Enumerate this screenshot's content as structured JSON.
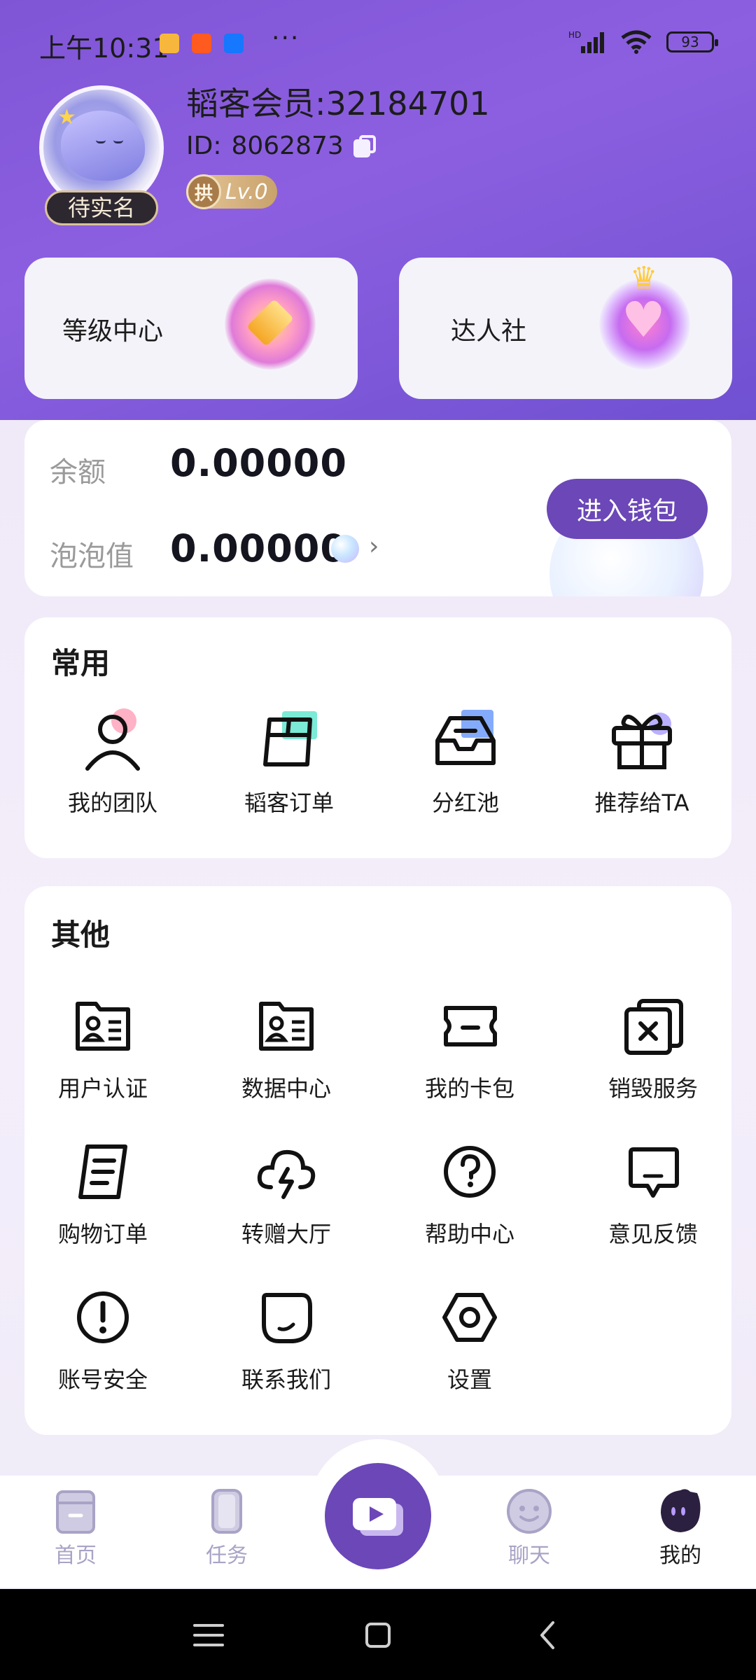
{
  "status_bar": {
    "time": "上午10:31",
    "dots": "···",
    "network": "HD",
    "battery": "93"
  },
  "profile": {
    "nickname": "韬客会员:32184701",
    "id_label": "ID:",
    "id_value": "8062873",
    "verify_badge": "待实名",
    "level": "Lv.0",
    "level_badge_char": "拱"
  },
  "top_cards": {
    "level_center": "等级中心",
    "talent_club": "达人社"
  },
  "wallet": {
    "balance_label": "余额",
    "balance_value": "0.00000",
    "bubble_label": "泡泡值",
    "bubble_value": "0.00000",
    "arrow": "›",
    "button": "进入钱包"
  },
  "common": {
    "title": "常用",
    "items": [
      {
        "label": "我的团队",
        "icon": "team-icon"
      },
      {
        "label": "韬客订单",
        "icon": "order-box-icon"
      },
      {
        "label": "分红池",
        "icon": "inbox-icon"
      },
      {
        "label": "推荐给TA",
        "icon": "gift-icon"
      }
    ]
  },
  "other": {
    "title": "其他",
    "items": [
      {
        "label": "用户认证",
        "icon": "id-card-icon"
      },
      {
        "label": "数据中心",
        "icon": "id-card-icon"
      },
      {
        "label": "我的卡包",
        "icon": "ticket-icon"
      },
      {
        "label": "销毁服务",
        "icon": "destroy-icon"
      },
      {
        "label": "购物订单",
        "icon": "document-icon"
      },
      {
        "label": "转赠大厅",
        "icon": "cloud-lightning-icon"
      },
      {
        "label": "帮助中心",
        "icon": "help-icon"
      },
      {
        "label": "意见反馈",
        "icon": "feedback-icon"
      },
      {
        "label": "账号安全",
        "icon": "warning-icon"
      },
      {
        "label": "联系我们",
        "icon": "contact-icon"
      },
      {
        "label": "设置",
        "icon": "settings-icon"
      }
    ]
  },
  "bottom_nav": {
    "items": [
      {
        "label": "首页",
        "icon": "home-icon"
      },
      {
        "label": "任务",
        "icon": "task-icon"
      },
      {
        "label": "聊天",
        "icon": "chat-icon"
      },
      {
        "label": "我的",
        "icon": "profile-icon"
      }
    ],
    "center_icon": "video-icon"
  },
  "colors": {
    "primary": "#6b47b8",
    "header_gradient_start": "#7f55d6",
    "header_gradient_end": "#6b4fcf",
    "nav_inactive": "#a9a3c6"
  }
}
